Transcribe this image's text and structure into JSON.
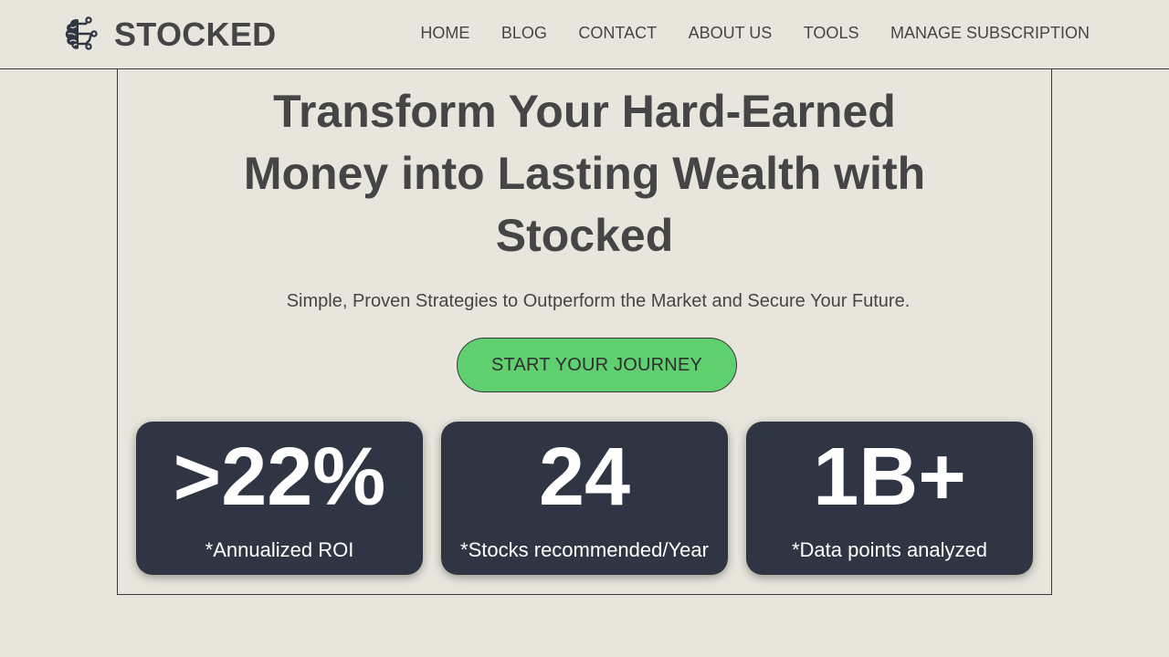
{
  "brand": {
    "name": "STOCKED",
    "icon": "brain-circuit-icon"
  },
  "nav": {
    "items": [
      "HOME",
      "BLOG",
      "CONTACT",
      "ABOUT US",
      "TOOLS",
      "MANAGE SUBSCRIPTION"
    ]
  },
  "hero": {
    "headline": "Transform Your Hard-Earned Money into Lasting Wealth with Stocked",
    "subtitle": "Simple, Proven Strategies to Outperform the Market and Secure Your Future.",
    "cta_label": "START YOUR JOURNEY"
  },
  "stats": [
    {
      "value": ">22%",
      "label": "*Annualized ROI"
    },
    {
      "value": "24",
      "label": "*Stocks recommended/Year"
    },
    {
      "value": "1B+",
      "label": "*Data points analyzed"
    }
  ],
  "colors": {
    "background": "#e8e6dc",
    "text": "#454545",
    "cta": "#5fcf6f",
    "card": "#2f3542"
  }
}
